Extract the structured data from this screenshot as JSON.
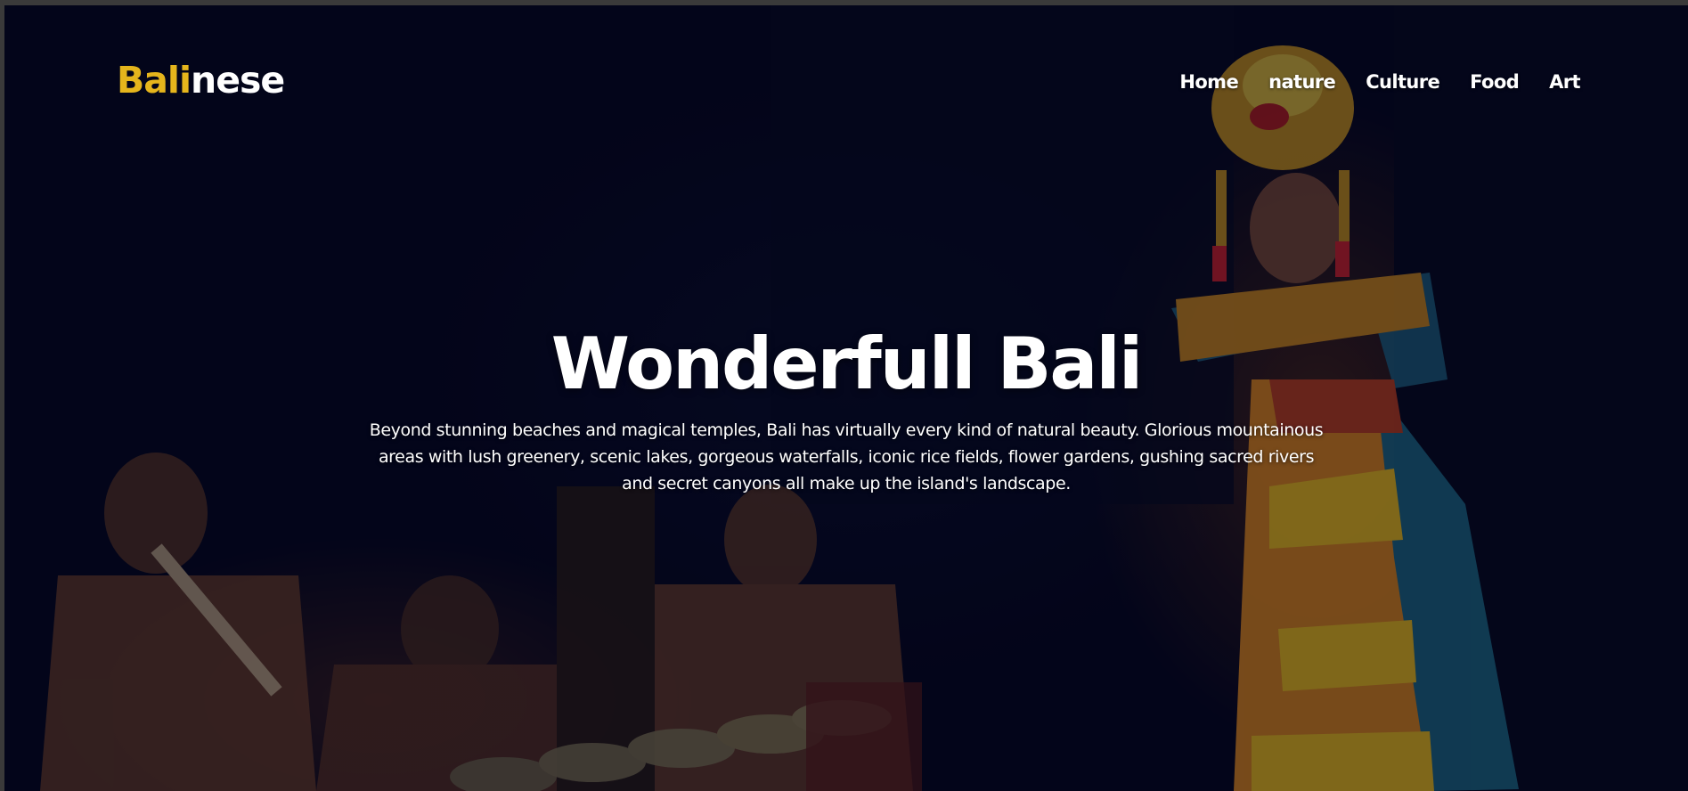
{
  "header": {
    "logo_accent": "Bali",
    "logo_rest": "nese",
    "nav": [
      {
        "label": "Home"
      },
      {
        "label": "nature"
      },
      {
        "label": "Culture"
      },
      {
        "label": "Food"
      },
      {
        "label": "Art"
      }
    ]
  },
  "hero": {
    "title": "Wonderfull Bali",
    "description": "Beyond stunning beaches and magical temples, Bali has virtually every kind of natural beauty. Glorious mountainous areas with lush greenery, scenic lakes, gorgeous waterfalls, iconic rice fields, flower gardens, gushing sacred rivers and secret canyons all make up the island's landscape."
  },
  "colors": {
    "accent": "#e5b51c",
    "text": "#ffffff",
    "background": "#04051a",
    "frame": "#3a3a3a"
  }
}
